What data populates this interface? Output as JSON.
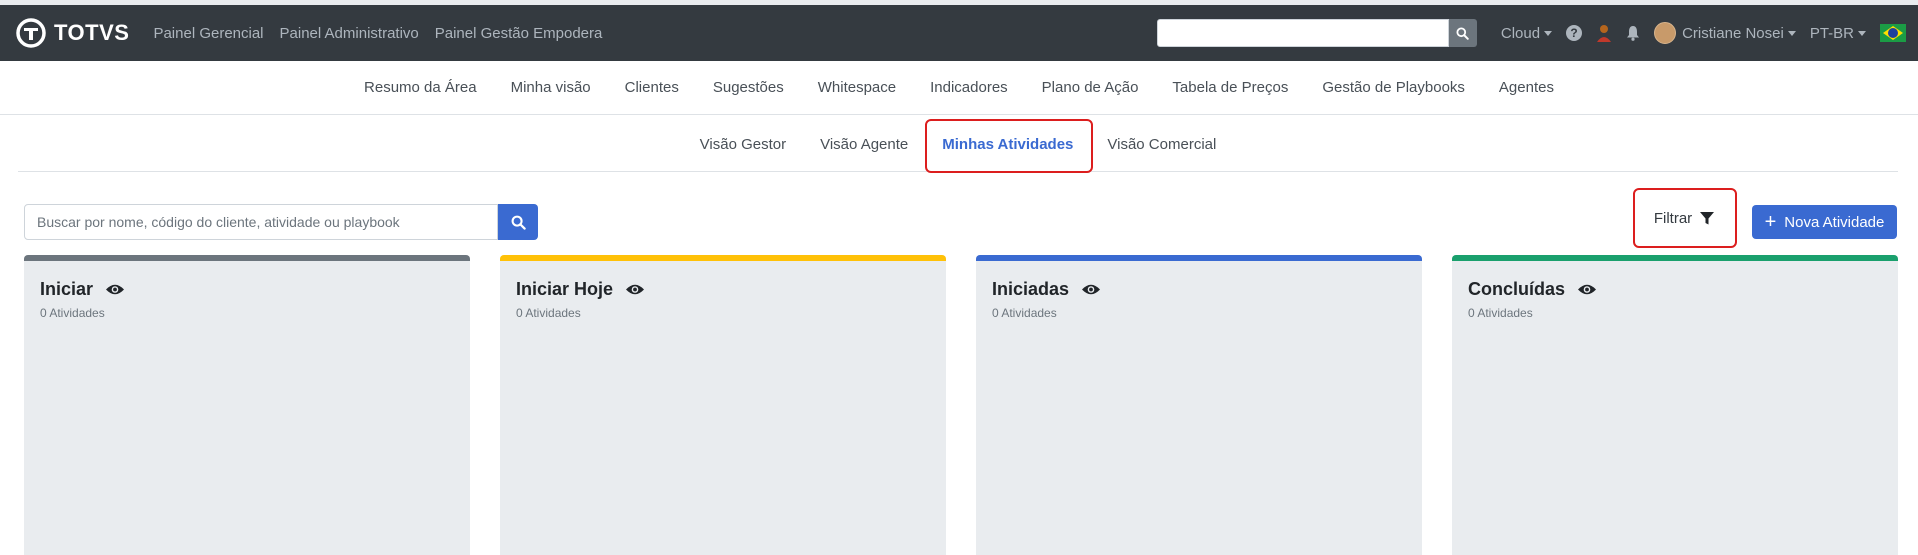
{
  "brand": {
    "name": "TOTVS"
  },
  "topnav": {
    "items": [
      "Painel Gerencial",
      "Painel Administrativo",
      "Painel Gestão Empodera"
    ]
  },
  "navbar_right": {
    "cloud": "Cloud",
    "user": "Cristiane Nosei",
    "lang": "PT-BR"
  },
  "mainnav": {
    "items": [
      "Resumo da Área",
      "Minha visão",
      "Clientes",
      "Sugestões",
      "Whitespace",
      "Indicadores",
      "Plano de Ação",
      "Tabela de Preços",
      "Gestão de Playbooks",
      "Agentes"
    ]
  },
  "subnav": {
    "items": [
      "Visão Gestor",
      "Visão Agente",
      "Minhas Atividades",
      "Visão Comercial"
    ],
    "active": "Minhas Atividades"
  },
  "toolbar": {
    "search_placeholder": "Buscar por nome, código do cliente, atividade ou playbook",
    "filter_label": "Filtrar",
    "new_activity_label": "Nova Atividade"
  },
  "columns": [
    {
      "title": "Iniciar",
      "count_label": "0 Atividades",
      "color": "#6c757d"
    },
    {
      "title": "Iniciar Hoje",
      "count_label": "0 Atividades",
      "color": "#ffc107"
    },
    {
      "title": "Iniciadas",
      "count_label": "0 Atividades",
      "color": "#3a6ad1"
    },
    {
      "title": "Concluídas",
      "count_label": "0 Atividades",
      "color": "#1aa06d"
    }
  ],
  "colors": {
    "navbar": "#343a40",
    "accent": "#3a6ad1",
    "highlight": "#dc1e1e"
  }
}
